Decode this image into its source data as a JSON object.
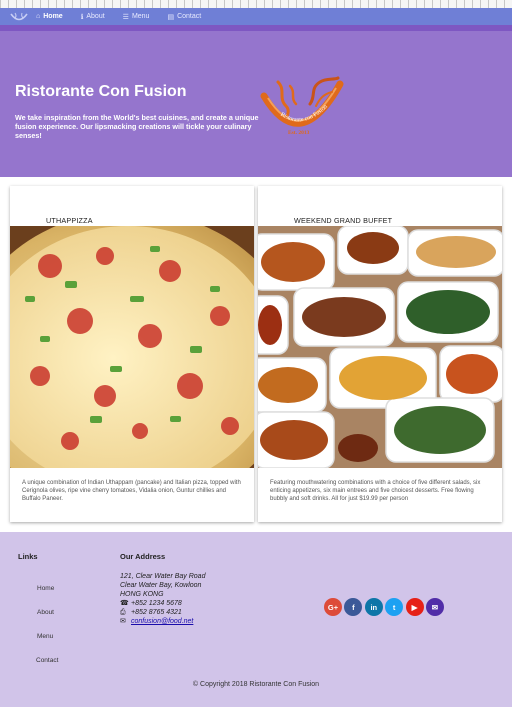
{
  "navbar": {
    "items": [
      {
        "label": "Home",
        "icon": "home-icon"
      },
      {
        "label": "About",
        "icon": "info-icon"
      },
      {
        "label": "Menu",
        "icon": "list-icon"
      },
      {
        "label": "Contact",
        "icon": "address-card-icon"
      }
    ],
    "color": "#6f7fd6"
  },
  "jumbotron": {
    "title": "Ristorante Con Fusion",
    "text": "We take inspiration from the World's best cuisines, and create a unique fusion experience. Our lipsmacking creations will tickle your culinary senses!",
    "logo": {
      "brand": "Ristorante con Fusion",
      "est": "Est. 2013"
    },
    "color": "#9575cd"
  },
  "cards": [
    {
      "title": "UTHAPPIZZA",
      "text": "A unique combination of Indian Uthappam (pancake) and Italian pizza, topped with Cerignola olives, ripe vine cherry tomatoes, Vidalia onion, Guntur chillies and Buffalo Paneer."
    },
    {
      "title": "WEEKEND GRAND BUFFET",
      "text": "Featuring mouthwatering combinations with a choice of five different salads, six enticing appetizers, six main entrees and five choicest desserts. Free flowing bubbly and soft drinks. All for just $19.99 per person"
    }
  ],
  "footer": {
    "links_heading": "Links",
    "links": [
      "Home",
      "About",
      "Menu",
      "Contact"
    ],
    "address_heading": "Our Address",
    "address": [
      "121, Clear Water Bay Road",
      "Clear Water Bay, Kowloon",
      "HONG KONG"
    ],
    "phone": "+852 1234 5678",
    "fax": "+852 8765 4321",
    "email": "confusion@food.net",
    "social": [
      {
        "label": "G+",
        "icon": "google-plus-icon",
        "color": "#dd4b39"
      },
      {
        "label": "f",
        "icon": "facebook-icon",
        "color": "#3b5998"
      },
      {
        "label": "in",
        "icon": "linkedin-icon",
        "color": "#0e76a8"
      },
      {
        "label": "t",
        "icon": "twitter-icon",
        "color": "#1da1f2"
      },
      {
        "label": "▶",
        "icon": "youtube-icon",
        "color": "#e62117"
      },
      {
        "label": "✉",
        "icon": "mail-icon",
        "color": "#512da8"
      }
    ],
    "copyright": "© Copyright 2018 Ristorante Con Fusion",
    "color": "#d1c4e9"
  }
}
